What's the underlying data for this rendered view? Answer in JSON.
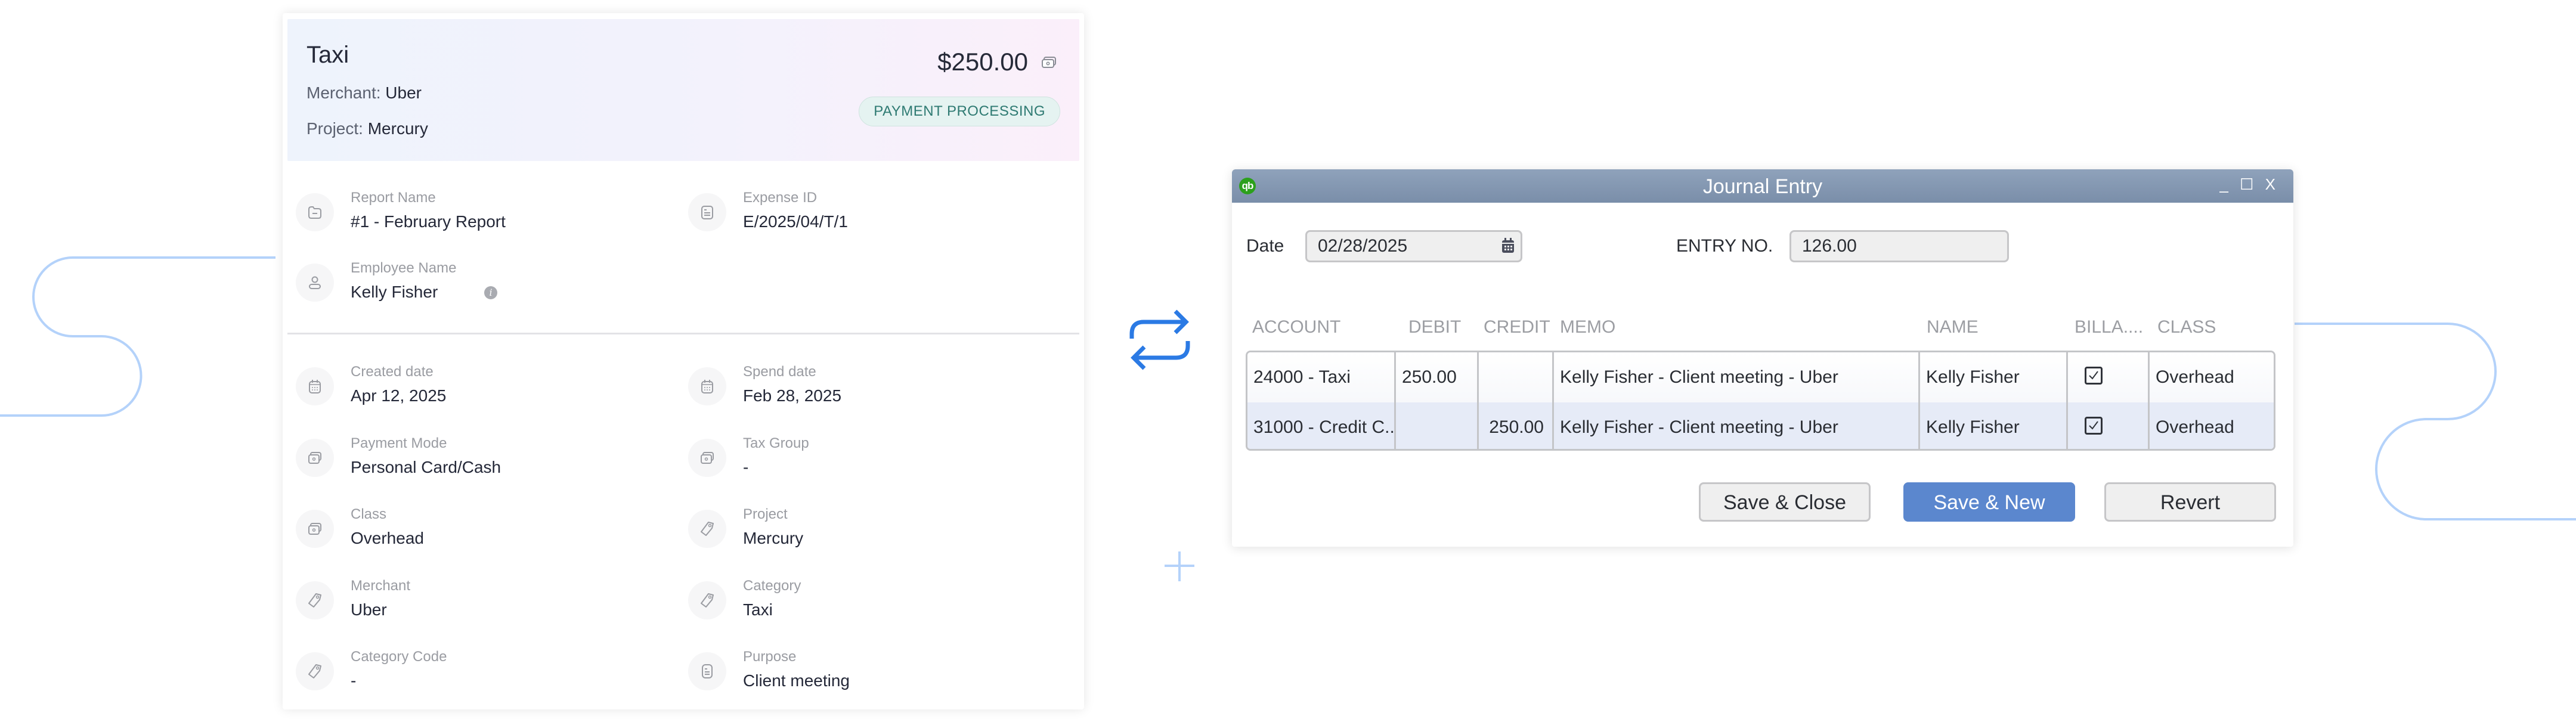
{
  "expense": {
    "title": "Taxi",
    "merchant_label": "Merchant:",
    "merchant_value": "Uber",
    "project_label": "Project:",
    "project_value": "Mercury",
    "amount": "$250.00",
    "status": "PAYMENT PROCESSING",
    "fields_top": [
      {
        "label": "Report Name",
        "value": "#1 - February Report",
        "icon": "folder-icon"
      },
      {
        "label": "Expense ID",
        "value": "E/2025/04/T/1",
        "icon": "document-icon"
      },
      {
        "label": "Employee Name",
        "value": "Kelly Fisher",
        "icon": "user-icon",
        "info_icon": "i"
      }
    ],
    "fields": [
      {
        "label": "Created date",
        "value": "Apr 12, 2025",
        "icon": "calendar-icon"
      },
      {
        "label": "Spend date",
        "value": "Feb 28, 2025",
        "icon": "calendar-icon"
      },
      {
        "label": "Payment Mode",
        "value": "Personal Card/Cash",
        "icon": "wallet-icon"
      },
      {
        "label": "Tax Group",
        "value": "-",
        "icon": "wallet-icon"
      },
      {
        "label": "Class",
        "value": "Overhead",
        "icon": "wallet-icon"
      },
      {
        "label": "Project",
        "value": "Mercury",
        "icon": "tag-icon"
      },
      {
        "label": "Merchant",
        "value": "Uber",
        "icon": "tag-icon"
      },
      {
        "label": "Category",
        "value": "Taxi",
        "icon": "tag-icon"
      },
      {
        "label": "Category Code",
        "value": "-",
        "icon": "tag-icon"
      },
      {
        "label": "Purpose",
        "value": "Client meeting",
        "icon": "document-icon"
      }
    ]
  },
  "journal": {
    "app_logo": "qb",
    "window_title": "Journal Entry",
    "window_controls": {
      "minimize": "_",
      "maximize": "☐",
      "close": "X"
    },
    "date_label": "Date",
    "date_value": "02/28/2025",
    "entry_label": "ENTRY NO.",
    "entry_value": "126.00",
    "columns": [
      "ACCOUNT",
      "DEBIT",
      "CREDIT",
      "MEMO",
      "NAME",
      "BILLA....",
      "CLASS"
    ],
    "rows": [
      {
        "account": "24000 - Taxi",
        "debit": "250.00",
        "credit": "",
        "memo": "Kelly Fisher - Client meeting - Uber",
        "name": "Kelly Fisher",
        "billable": true,
        "class": "Overhead"
      },
      {
        "account": "31000 - Credit C..",
        "debit": "",
        "credit": "250.00",
        "memo": "Kelly Fisher - Client meeting - Uber",
        "name": "Kelly Fisher",
        "billable": true,
        "class": "Overhead"
      }
    ],
    "buttons": {
      "save_close": "Save & Close",
      "save_new": "Save & New",
      "revert": "Revert"
    }
  },
  "colors": {
    "accent_blue": "#5b87ce",
    "sync_icon": "#2b7ae4",
    "decor_line": "#b4d2fa",
    "status_badge_text": "#2e7a72",
    "qb_green": "#2ca01c"
  }
}
